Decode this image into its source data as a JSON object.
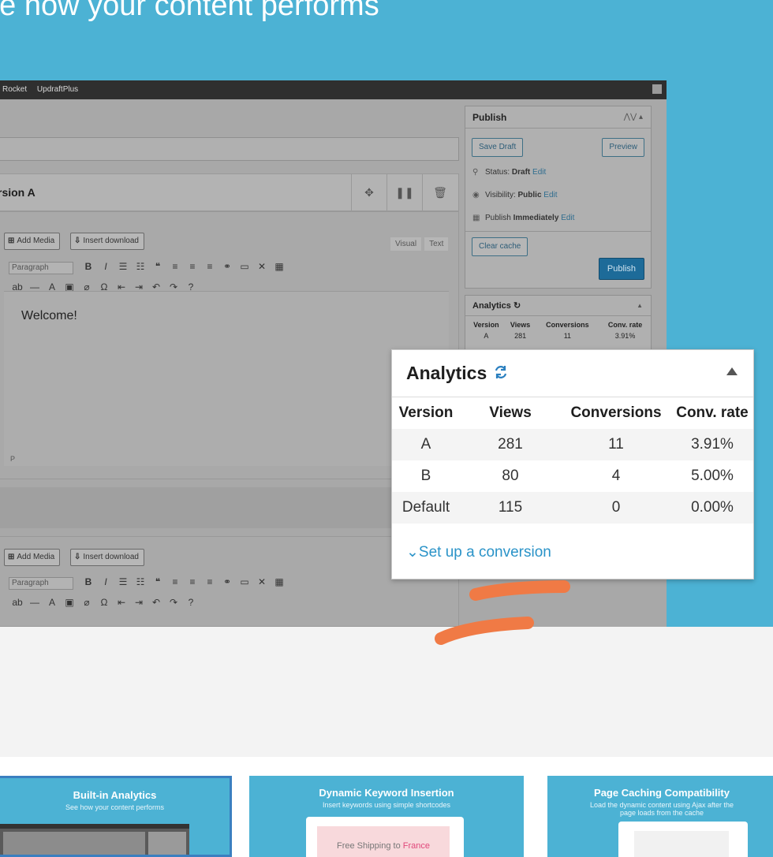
{
  "hero": {
    "title": "ee how your content performs"
  },
  "admin_bar": {
    "items": [
      "Rocket",
      "UpdraftPlus"
    ]
  },
  "editor": {
    "version_title": "rsion A",
    "add_media": "Add Media",
    "insert_download": "Insert download",
    "tab_visual": "Visual",
    "tab_text": "Text",
    "format_select": "Paragraph",
    "content": "Welcome!",
    "path": "P"
  },
  "publish": {
    "title": "Publish",
    "save_draft": "Save Draft",
    "preview": "Preview",
    "status_label": "Status:",
    "status_value": "Draft",
    "visibility_label": "Visibility:",
    "visibility_value": "Public",
    "publish_label": "Publish",
    "publish_value": "Immediately",
    "edit": "Edit",
    "clear_cache": "Clear cache",
    "publish_button": "Publish"
  },
  "analytics_small": {
    "title": "Analytics",
    "columns": [
      "Version",
      "Views",
      "Conversions",
      "Conv. rate"
    ],
    "rows": [
      [
        "A",
        "281",
        "11",
        "3.91%"
      ]
    ]
  },
  "analytics": {
    "title": "Analytics",
    "columns": [
      "Version",
      "Views",
      "Conversions",
      "Conv. rate"
    ],
    "rows": [
      [
        "A",
        "281",
        "11",
        "3.91%"
      ],
      [
        "B",
        "80",
        "4",
        "5.00%"
      ],
      [
        "Default",
        "115",
        "0",
        "0.00%"
      ]
    ],
    "setup_link": "Set up a conversion"
  },
  "tiles": [
    {
      "title": "Built-in Analytics",
      "subtitle": "See how your content performs"
    },
    {
      "title": "Dynamic Keyword Insertion",
      "subtitle": "Insert keywords using simple shortcodes",
      "demo_text": "Free Shipping to ",
      "demo_highlight": "France"
    },
    {
      "title": "Page Caching Compatibility",
      "subtitle": "Load the dynamic content using Ajax after the page loads from the cache"
    }
  ],
  "colors": {
    "hero": "#4cb2d4",
    "accent": "#2a93c8",
    "swoosh": "#f07a45"
  }
}
